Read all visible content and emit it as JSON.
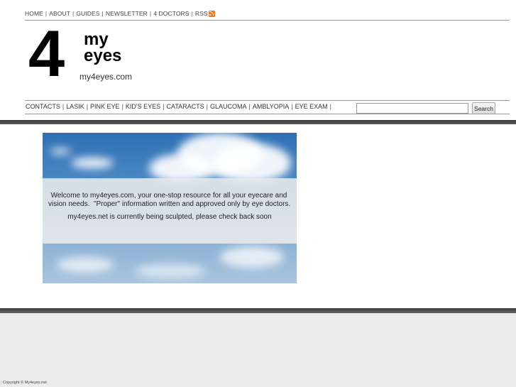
{
  "top_nav": {
    "items": [
      "HOME",
      "ABOUT",
      "GUIDES",
      "NEWSLETTER",
      "4 DOCTORS",
      "RSS"
    ]
  },
  "logo": {
    "numeral": "4",
    "word1": "my",
    "word2": "eyes",
    "url": "my4eyes.com"
  },
  "category_nav": {
    "items": [
      "CONTACTS",
      "LASIK",
      "PINK EYE",
      "KID'S EYES",
      "CATARACTS",
      "GLAUCOMA",
      "AMBLYOPIA",
      "EYE EXAM"
    ]
  },
  "search": {
    "value": "",
    "button_label": "Search"
  },
  "hero": {
    "line1": "Welcome to my4eyes.com, your one-stop resource for all your eyecare and",
    "line2": "vision needs.  \"Proper\" information written and approved only by eye doctors.",
    "line3": "my4eyes.net is currently being sculpted, please check back soon"
  },
  "footer": {
    "copyright": "Copyright © My4eyes.net"
  },
  "colors": {
    "rss": "#f27a1a",
    "band": "#3c3c3c",
    "footer_bg": "#ebebeb"
  }
}
